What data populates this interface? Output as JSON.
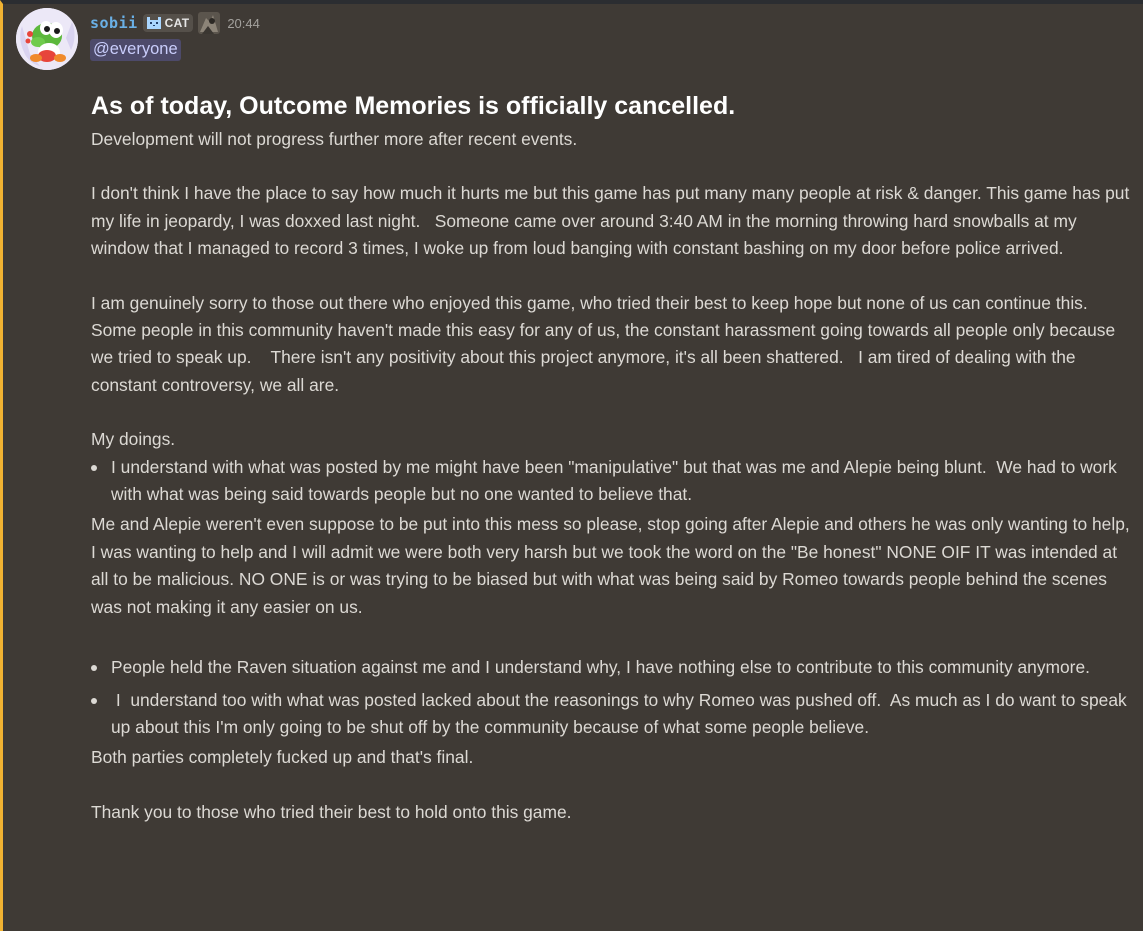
{
  "message": {
    "author": {
      "username": "sobii",
      "clan_tag": "CAT",
      "clan_icon": "cat-pixel-icon",
      "role_icon": "role-image-icon",
      "avatar_icon": "green-dinosaur-avatar"
    },
    "timestamp": "20:44",
    "mention": "@everyone",
    "heading": "As of today, Outcome Memories is officially cancelled.",
    "paragraph_1": "Development will not progress further more after recent events.",
    "paragraph_2": "I don't think I have the place to say how much it hurts me but this game has put many many people at risk & danger. This game has put my life in jeopardy, I was doxxed last night.   Someone came over around 3:40 AM in the morning throwing hard snowballs at my window that I managed to record 3 times, I woke up from loud banging with constant bashing on my door before police arrived.",
    "paragraph_3a": "I am genuinely sorry to those out there who enjoyed this game, who tried their best to keep hope but none of us can continue this.",
    "paragraph_3b": "Some people in this community haven't made this easy for any of us, the constant harassment going towards all people only because we tried to speak up.    There isn't any positivity about this project anymore, it's all been shattered.   I am tired of dealing with the constant controversy, we all are.",
    "doings_heading": "My doings.",
    "bullet_1": "I understand with what was posted by me might have been \"manipulative\" but that was me and Alepie being blunt.  We had to work with what was being said towards people but no one wanted to believe that.",
    "paragraph_4": "Me and Alepie weren't even suppose to be put into this mess so please, stop going after Alepie and others he was only wanting to help, I was wanting to help and I will admit we were both very harsh but we took the word on the \"Be honest\" NONE OIF IT was intended at all to be malicious. NO ONE is or was trying to be biased but with what was being said by Romeo towards people behind the scenes was not making it any easier on us.",
    "bullet_2": "People held the Raven situation against me and I understand why, I have nothing else to contribute to this community anymore.",
    "bullet_3": " I  understand too with what was posted lacked about the reasonings to why Romeo was pushed off.  As much as I do want to speak up about this I'm only going to be shut off by the community because of what some people believe.",
    "paragraph_5": "Both parties completely fucked up and that's final.",
    "paragraph_6": "Thank you to those who tried their best to hold onto this game."
  },
  "colors": {
    "background": "#3f3a35",
    "highlight_bar": "#f0b232",
    "username": "#6ab0e6",
    "mention_bg": "#4d4a6a",
    "mention_text": "#c9cdfb",
    "body_text": "#dcd9d4",
    "heading_text": "#ffffff",
    "timestamp": "#a3a19d"
  }
}
